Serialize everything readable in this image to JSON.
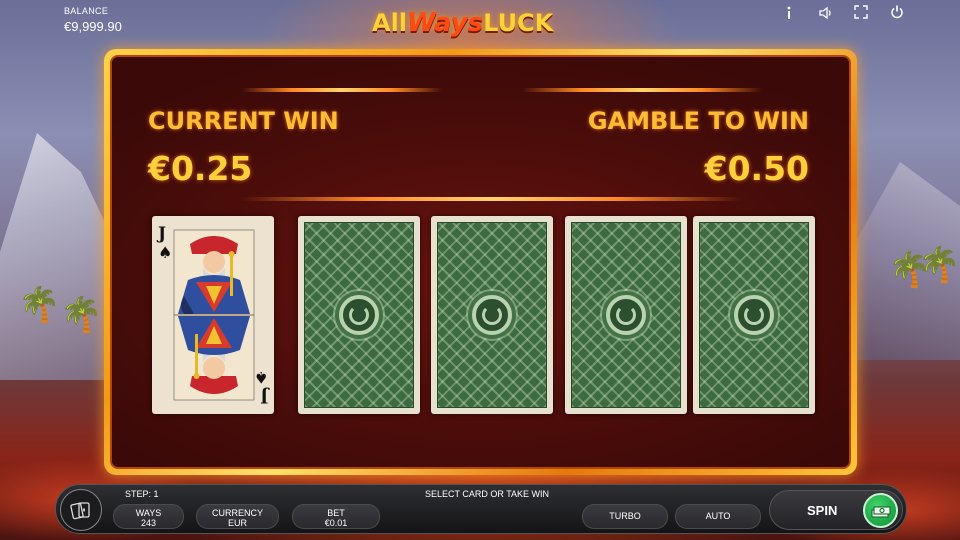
{
  "header": {
    "balance_label": "BALANCE",
    "balance_value": "€9,999.90",
    "logo": {
      "part1": "All",
      "part2": "Ways",
      "part3": "LUCK"
    },
    "icons": [
      "info-icon",
      "sound-icon",
      "fullscreen-icon",
      "power-icon"
    ]
  },
  "gamble": {
    "current_win_label": "CURRENT WIN",
    "current_win_value": "€0.25",
    "gamble_to_win_label": "GAMBLE TO WIN",
    "gamble_to_win_value": "€0.50",
    "dealer_card": {
      "rank": "J",
      "suit": "♠"
    },
    "face_down_cards": 4
  },
  "controls": {
    "step_label": "STEP: 1",
    "status_text": "SELECT CARD OR TAKE WIN",
    "ways_label": "WAYS",
    "ways_value": "243",
    "currency_label": "CURRENCY",
    "currency_value": "EUR",
    "bet_label": "BET",
    "bet_value": "€0.01",
    "turbo_label": "TURBO",
    "auto_label": "AUTO",
    "spin_label": "SPIN"
  },
  "colors": {
    "gold_text": "#ffbd35",
    "panel_frame": "#f29a18",
    "card_back_green": "#3d6b3f",
    "spin_green": "#1fae48"
  }
}
